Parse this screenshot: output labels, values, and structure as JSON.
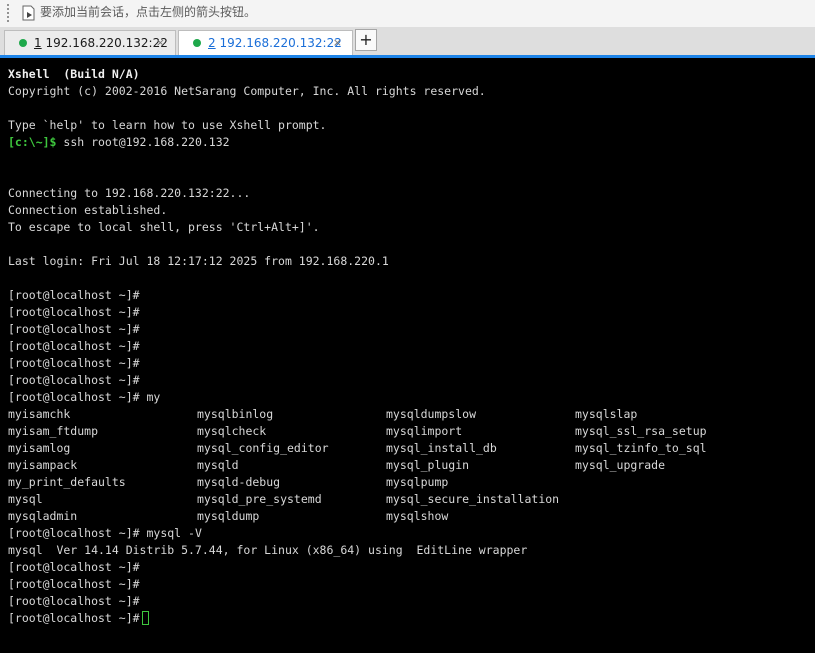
{
  "hint_bar": {
    "text": "要添加当前会话，点击左侧的箭头按钮。",
    "icon": "arrow-add-session-icon"
  },
  "tabs": [
    {
      "number": "1",
      "title": "192.168.220.132:22",
      "active": false,
      "status_color": "#1ea84a",
      "close": "×"
    },
    {
      "number": "2",
      "title": "192.168.220.132:22",
      "active": true,
      "status_color": "#1ea84a",
      "close": "×"
    }
  ],
  "add_tab_label": "+",
  "accent_color": "#1e84e8",
  "terminal": {
    "banner_title": "Xshell  (Build N/A)",
    "copyright": "Copyright (c) 2002-2016 NetSarang Computer, Inc. All rights reserved.",
    "help_line": "Type `help' to learn how to use Xshell prompt.",
    "local_prompt": "[c:\\~]$",
    "ssh_command": " ssh root@192.168.220.132",
    "connecting": "Connecting to 192.168.220.132:22...",
    "established": "Connection established.",
    "escape_hint": "To escape to local shell, press 'Ctrl+Alt+]'.",
    "last_login": "Last login: Fri Jul 18 12:17:12 2025 from 192.168.220.1",
    "prompt": "[root@localhost ~]#",
    "typed_my": " my",
    "completions": [
      [
        "myisamchk",
        "mysqlbinlog",
        "mysqldumpslow",
        "mysqlslap"
      ],
      [
        "myisam_ftdump",
        "mysqlcheck",
        "mysqlimport",
        "mysql_ssl_rsa_setup"
      ],
      [
        "myisamlog",
        "mysql_config_editor",
        "mysql_install_db",
        "mysql_tzinfo_to_sql"
      ],
      [
        "myisampack",
        "mysqld",
        "mysql_plugin",
        "mysql_upgrade"
      ],
      [
        "my_print_defaults",
        "mysqld-debug",
        "mysqlpump",
        ""
      ],
      [
        "mysql",
        "mysqld_pre_systemd",
        "mysql_secure_installation",
        ""
      ],
      [
        "mysqladmin",
        "mysqldump",
        "mysqlshow",
        ""
      ]
    ],
    "typed_version": " mysql -V",
    "version_output": "mysql  Ver 14.14 Distrib 5.7.44, for Linux (x86_64) using  EditLine wrapper"
  }
}
